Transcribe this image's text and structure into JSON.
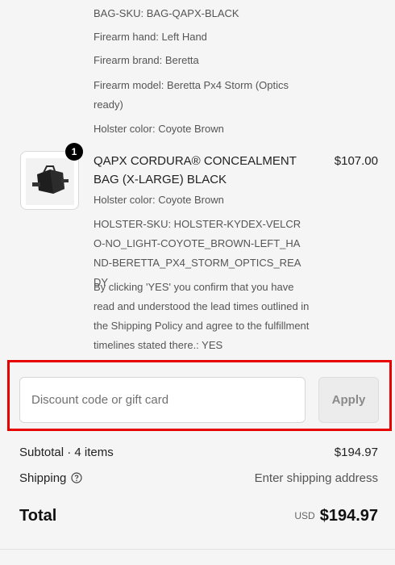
{
  "previous_item": {
    "lines": [
      "BAG-SKU: BAG-QAPX-BLACK",
      "Firearm hand: Left Hand",
      "Firearm brand: Beretta",
      "Firearm model: Beretta Px4 Storm (Optics ready)",
      "Holster color: Coyote Brown"
    ]
  },
  "item": {
    "quantity": "1",
    "image_icon": "black-bag-product-photo",
    "title": "QAPX CORDURA® CONCEALMENT BAG (X-LARGE) BLACK",
    "price": "$107.00",
    "properties": [
      "Holster color: Coyote Brown",
      "HOLSTER-SKU: HOLSTER-KYDEX-VELCRO-NO_LIGHT-COYOTE_BROWN-LEFT_HAND-BERETTA_PX4_STORM_OPTICS_READY",
      "By clicking 'YES' you confirm that you have read and understood the lead times outlined in the Shipping Policy and agree to the fulfillment timelines stated there.: YES"
    ]
  },
  "discount": {
    "placeholder": "Discount code or gift card",
    "value": "",
    "apply_label": "Apply",
    "highlight_color": "#e60000"
  },
  "summary": {
    "subtotal_label": "Subtotal · 4 items",
    "subtotal_value": "$194.97",
    "shipping_label": "Shipping",
    "shipping_value": "Enter shipping address",
    "total_label": "Total",
    "currency": "USD",
    "total_value": "$194.97"
  }
}
